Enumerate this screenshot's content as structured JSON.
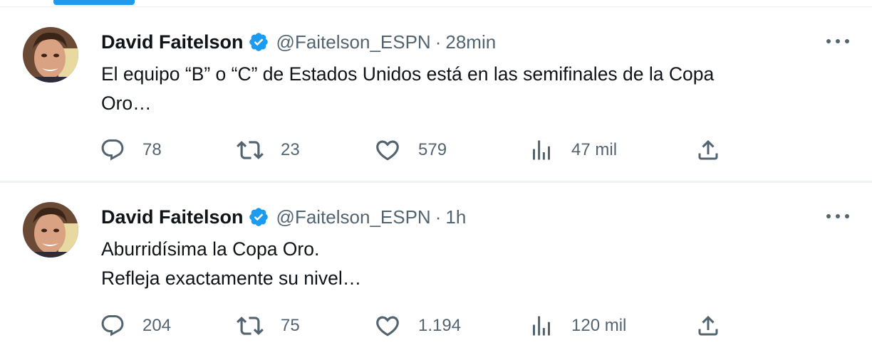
{
  "tweets": [
    {
      "author_name": "David Faitelson",
      "handle": "@Faitelson_ESPN",
      "separator": "·",
      "time": "28min",
      "text_lines": [
        "El equipo “B” o “C” de Estados Unidos está en las semifinales de la Copa",
        "Oro…"
      ],
      "replies": "78",
      "retweets": "23",
      "likes": "579",
      "views": "47 mil"
    },
    {
      "author_name": "David Faitelson",
      "handle": "@Faitelson_ESPN",
      "separator": "·",
      "time": "1h",
      "text_lines": [
        "Aburridísima la Copa Oro.",
        "Refleja exactamente su nivel…"
      ],
      "replies": "204",
      "retweets": "75",
      "likes": "1.194",
      "views": "120 mil"
    }
  ],
  "colors": {
    "accent": "#1d9bf0",
    "text_primary": "#0f1419",
    "text_secondary": "#536471",
    "divider": "#eff3f4"
  },
  "icons": [
    "reply-icon",
    "retweet-icon",
    "like-icon",
    "views-icon",
    "share-icon",
    "verified-badge-icon",
    "more-options-icon"
  ]
}
